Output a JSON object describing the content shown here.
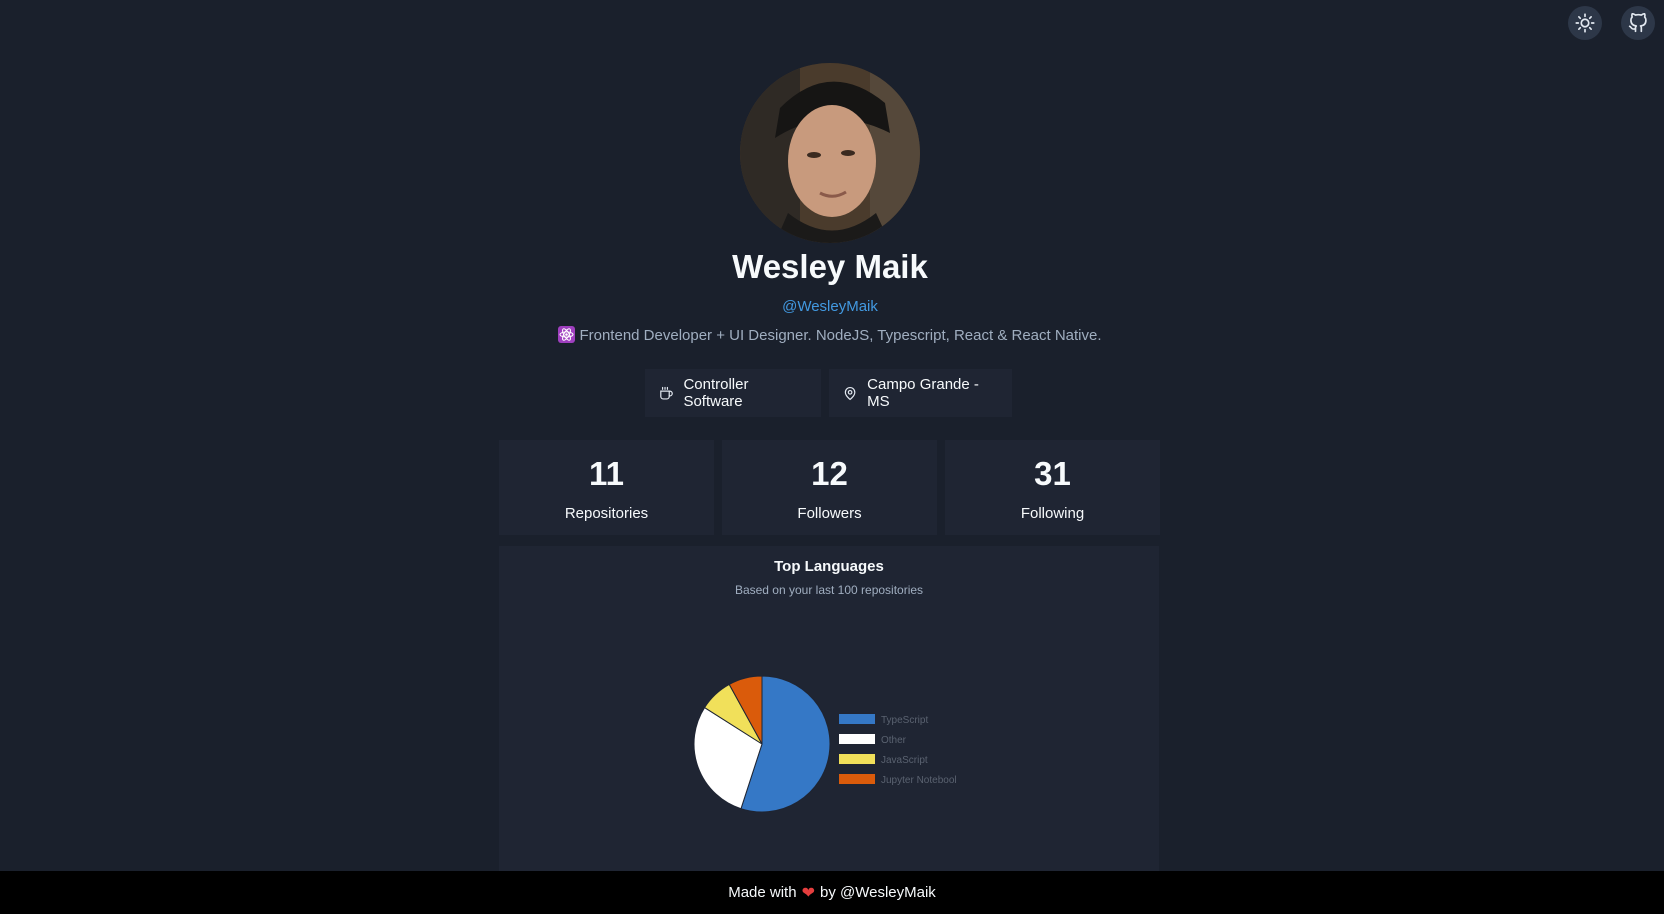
{
  "header": {
    "theme_toggle_icon": "sun-icon",
    "github_icon": "github-icon"
  },
  "profile": {
    "name": "Wesley Maik",
    "handle": "@WesleyMaik",
    "bio": "Frontend Developer + UI Designer. NodeJS, Typescript, React & React Native.",
    "bio_emoji": "atom-icon",
    "company": "Controller Software",
    "company_icon": "coffee-cup-icon",
    "location": "Campo Grande - MS",
    "location_icon": "map-pin-icon"
  },
  "stats": [
    {
      "value": "11",
      "label": "Repositories"
    },
    {
      "value": "12",
      "label": "Followers"
    },
    {
      "value": "31",
      "label": "Following"
    }
  ],
  "languages": {
    "title": "Top Languages",
    "subtitle": "Based on your last 100 repositories"
  },
  "chart_data": {
    "type": "pie",
    "categories": [
      "TypeScript",
      "Other",
      "JavaScript",
      "Jupyter Notebool"
    ],
    "values": [
      55,
      29,
      8,
      8
    ],
    "colors": [
      "#3578c6",
      "#ffffff",
      "#f1e05a",
      "#da5b0b"
    ],
    "legend_position": "right"
  },
  "footer": {
    "prefix": "Made with",
    "heart_icon": "heart-icon",
    "suffix": "by @WesleyMaik"
  }
}
